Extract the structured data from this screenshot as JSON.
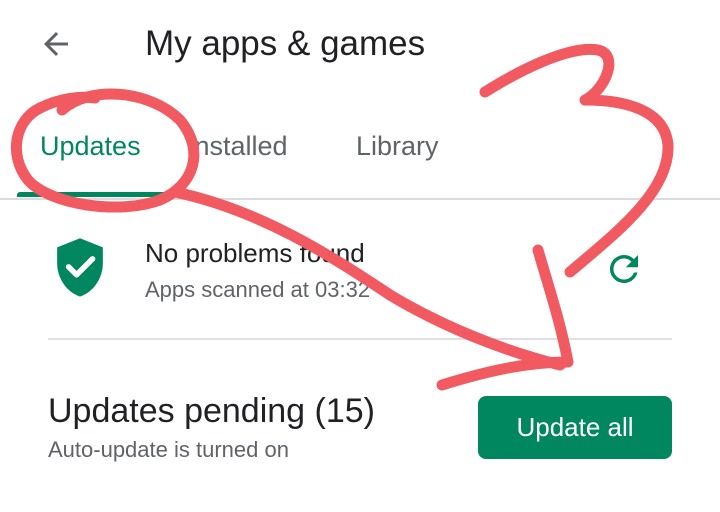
{
  "header": {
    "title": "My apps & games",
    "back_icon": "arrow-back-icon"
  },
  "tabs": [
    {
      "label": "Updates",
      "active": true
    },
    {
      "label": "Installed",
      "active": false
    },
    {
      "label": "Library",
      "active": false
    }
  ],
  "security": {
    "title": "No problems found",
    "subtitle": "Apps scanned at 03:32",
    "icon": "shield-check-icon",
    "refresh_icon": "refresh-icon"
  },
  "updates": {
    "title": "Updates pending (15)",
    "subtitle": "Auto-update is turned on",
    "button_label": "Update all"
  },
  "colors": {
    "accent": "#01875f",
    "annotation": "#f25a61",
    "text_primary": "#202124",
    "text_secondary": "#5f6368"
  }
}
